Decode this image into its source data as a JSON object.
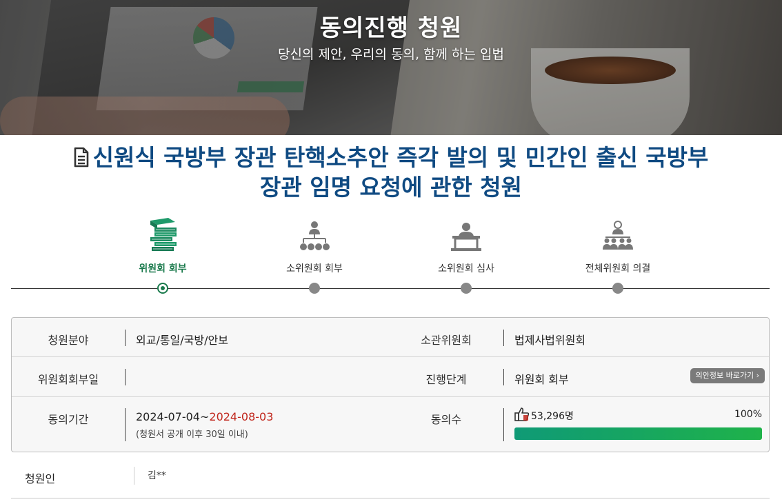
{
  "banner": {
    "title": "동의진행 청원",
    "subtitle": "당신의 제안, 우리의 동의, 함께 하는 입법"
  },
  "petition": {
    "title": "신원식 국방부 장관 탄핵소추안 즉각 발의 및 민간인 출신 국방부장관 임명 요청에 관한 청원"
  },
  "steps": [
    {
      "label": "위원회 회부",
      "icon": "documents-stack-icon",
      "active": true
    },
    {
      "label": "소위원회 회부",
      "icon": "org-chart-icon",
      "active": false
    },
    {
      "label": "소위원회 심사",
      "icon": "podium-speaker-icon",
      "active": false
    },
    {
      "label": "전체위원회 의결",
      "icon": "audience-group-icon",
      "active": false
    }
  ],
  "info": {
    "field_label": "청원분야",
    "field_value": "외교/통일/국방/안보",
    "committee_label": "소관위원회",
    "committee_value": "법제사법위원회",
    "referral_date_label": "위원회회부일",
    "referral_date_value": "",
    "stage_label": "진행단계",
    "stage_value": "위원회 회부",
    "bill_info_button": "의안정보 바로가기",
    "period_label": "동의기간",
    "period_start": "2024-07-04~",
    "period_end": "2024-08-03",
    "period_note": "(청원서 공개 이후 30일 이내)",
    "agree_label": "동의수",
    "agree_count": "53,296명",
    "agree_percent": "100%",
    "agree_progress": 1.0
  },
  "petitioner": {
    "label": "청원인",
    "value": "김**"
  },
  "colors": {
    "title_blue": "#0f4a82",
    "active_green": "#1a7a4c",
    "deadline_red": "#c0261c",
    "progress_start": "#0f9a76",
    "progress_end": "#1fb24a"
  }
}
